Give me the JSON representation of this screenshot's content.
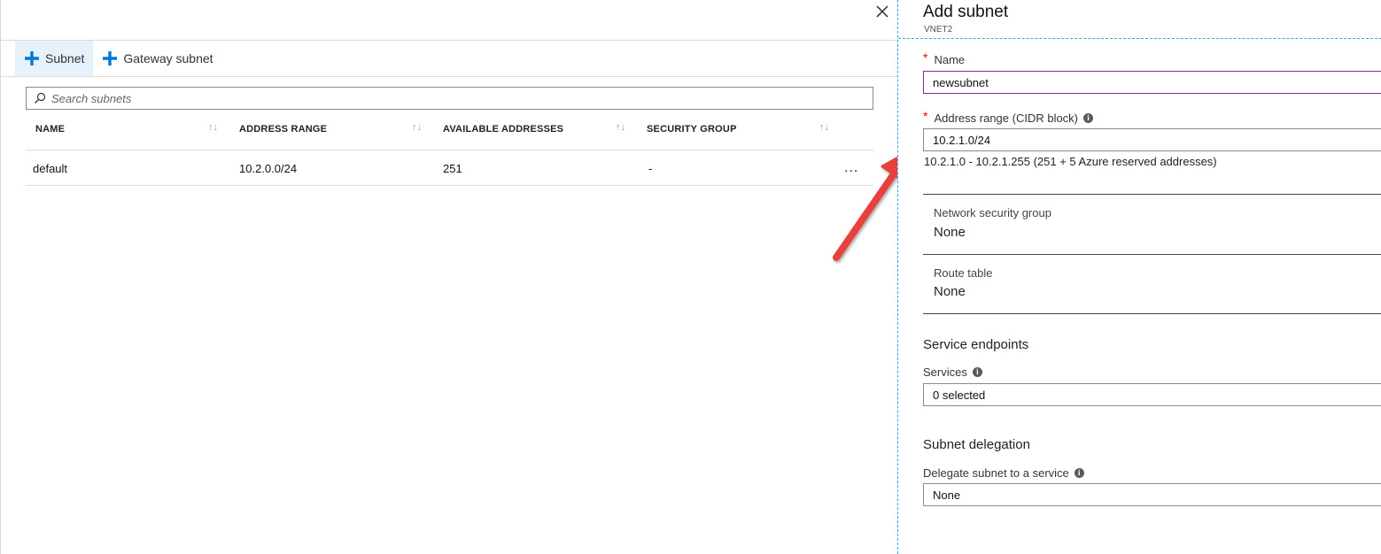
{
  "left_blade": {
    "toolbar": {
      "subnet_label": "Subnet",
      "gateway_subnet_label": "Gateway subnet"
    },
    "search": {
      "placeholder": "Search subnets"
    },
    "table": {
      "columns": [
        "NAME",
        "ADDRESS RANGE",
        "AVAILABLE ADDRESSES",
        "SECURITY GROUP"
      ],
      "rows": [
        {
          "name": "default",
          "address_range": "10.2.0.0/24",
          "available_addresses": "251",
          "security_group": "-"
        }
      ],
      "row_menu": "..."
    }
  },
  "right_blade": {
    "title": "Add subnet",
    "subtitle": "VNET2",
    "required_marker": "*",
    "name": {
      "label": "Name",
      "value": "newsubnet"
    },
    "address_range": {
      "label": "Address range (CIDR block)",
      "value": "10.2.1.0/24",
      "hint": "10.2.1.0 - 10.2.1.255 (251 + 5 Azure reserved addresses)"
    },
    "network_security_group": {
      "label": "Network security group",
      "value": "None"
    },
    "route_table": {
      "label": "Route table",
      "value": "None"
    },
    "service_endpoints": {
      "section_title": "Service endpoints",
      "services_label": "Services",
      "services_value": "0 selected"
    },
    "subnet_delegation": {
      "section_title": "Subnet delegation",
      "delegate_label": "Delegate subnet to a service",
      "delegate_value": "None"
    }
  },
  "colors": {
    "accent_blue": "#0078d4",
    "blade_border": "#2aa8d8",
    "arrow_red": "#e8413c",
    "required_red": "#ee0000",
    "focus_border": "#7a2d8a"
  }
}
